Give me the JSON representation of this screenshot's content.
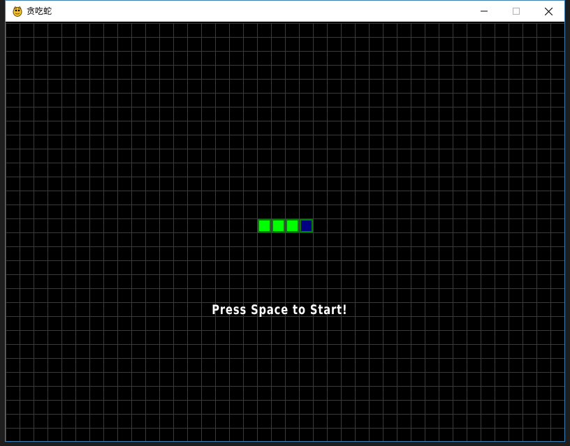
{
  "window": {
    "title": "贪吃蛇",
    "app_icon": "python-snake-icon",
    "controls": {
      "minimize": "minimize-icon",
      "maximize": "maximize-icon",
      "close": "close-icon"
    }
  },
  "game": {
    "prompt": "Press Space to Start!",
    "grid": {
      "cols": 40,
      "rows": 30
    },
    "snake": {
      "body_cells": [
        [
          18,
          14
        ],
        [
          19,
          14
        ],
        [
          20,
          14
        ]
      ],
      "head_cell": [
        21,
        14
      ],
      "colors": {
        "body": "#00ff00",
        "body_border": "#008000",
        "head": "#000080"
      }
    },
    "colors": {
      "background": "#000000",
      "grid_line": "#3a3a3a",
      "text": "#ffffff"
    }
  }
}
